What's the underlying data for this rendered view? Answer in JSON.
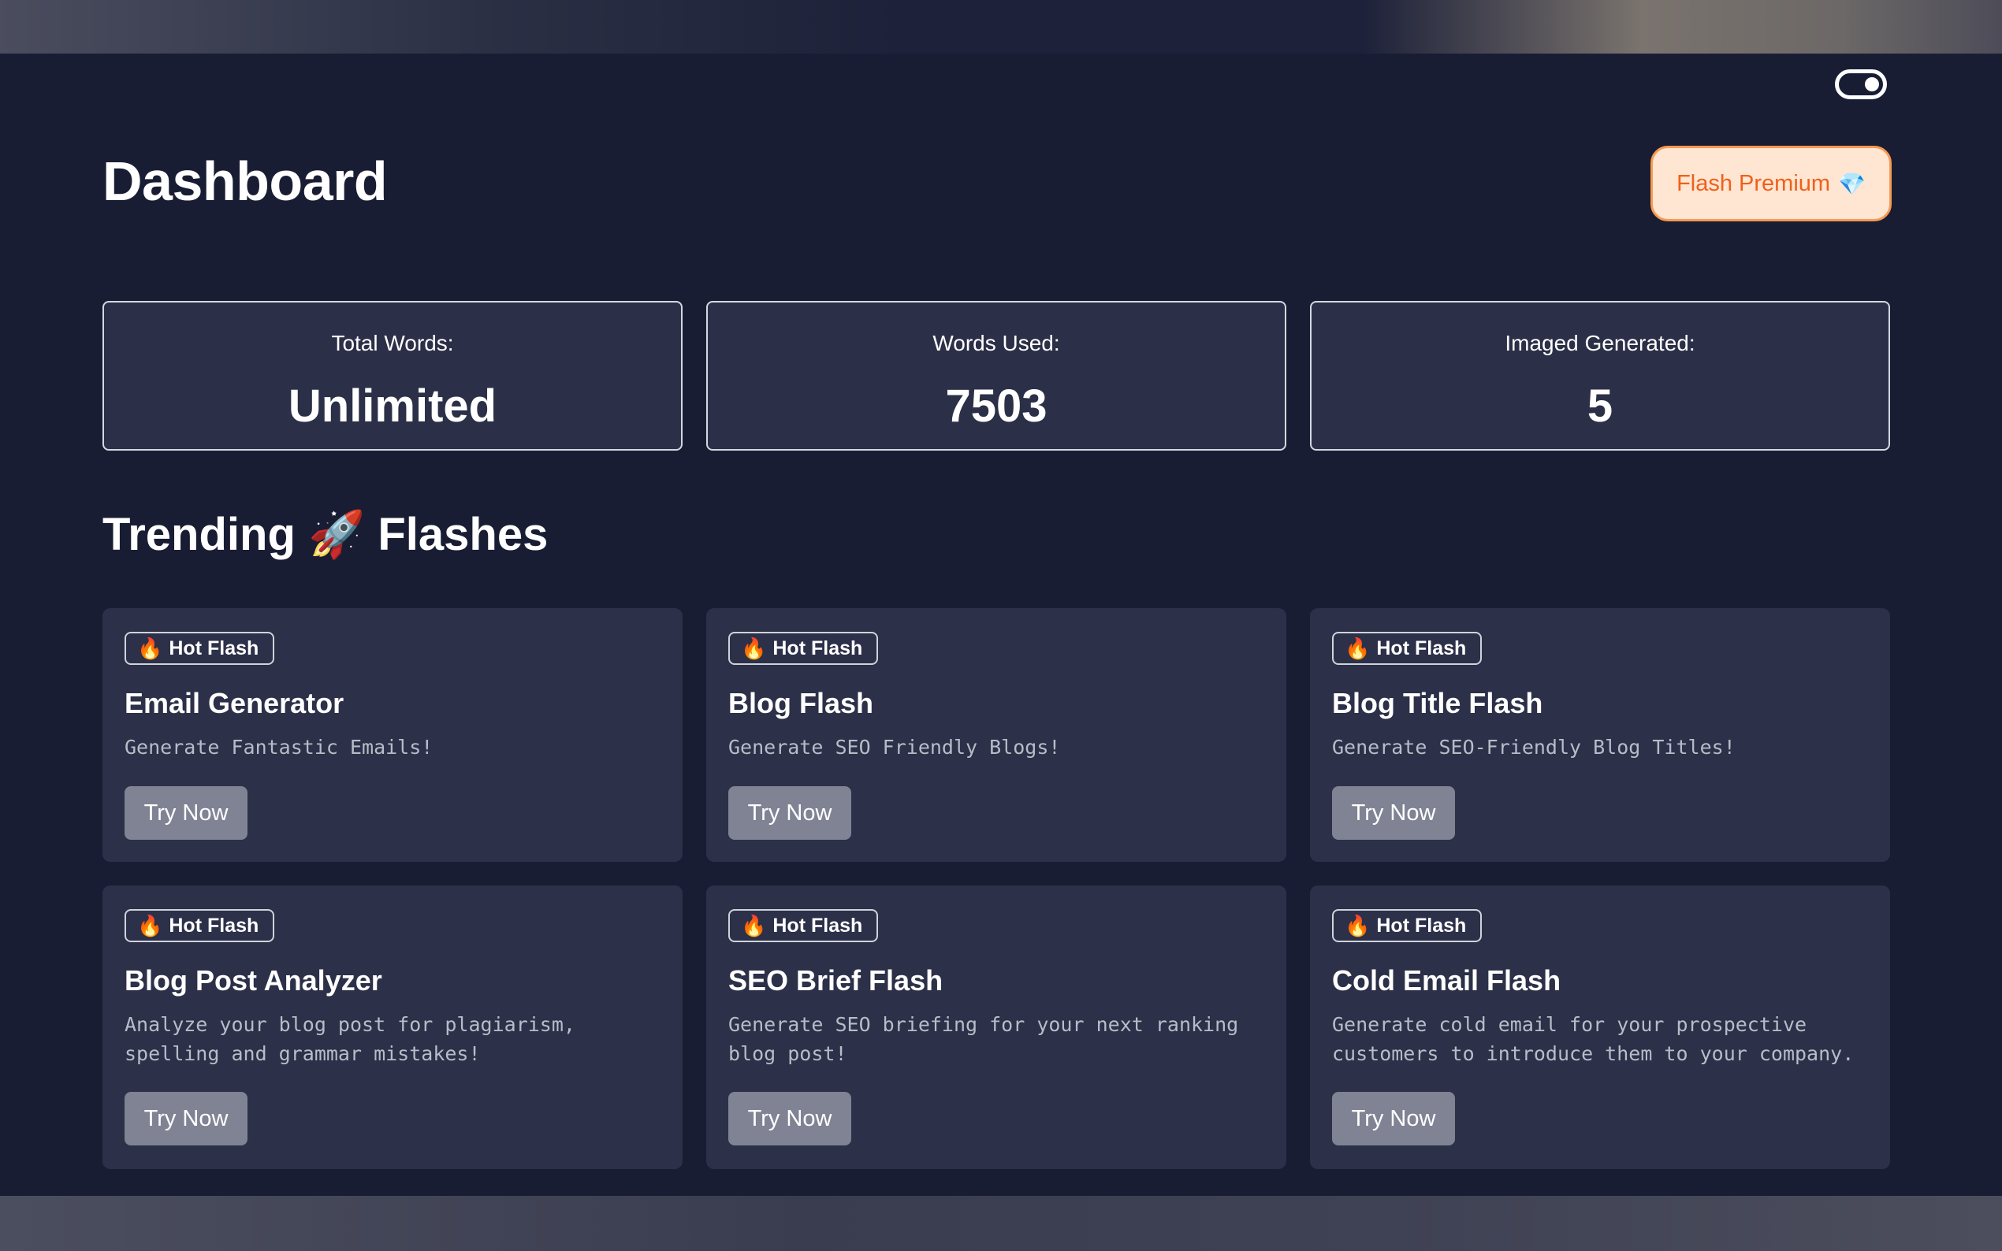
{
  "header": {
    "title": "Dashboard",
    "premium_label": "Flash Premium",
    "premium_icon": "💎"
  },
  "stats": [
    {
      "label": "Total Words:",
      "value": "Unlimited"
    },
    {
      "label": "Words Used:",
      "value": "7503"
    },
    {
      "label": "Imaged Generated:",
      "value": "5"
    }
  ],
  "section": {
    "title_before": "Trending",
    "title_icon": "🚀",
    "title_after": "Flashes"
  },
  "badge": {
    "icon": "🔥",
    "label": "Hot Flash"
  },
  "cards": [
    {
      "title": "Email Generator",
      "desc": "Generate Fantastic Emails!",
      "button": "Try Now"
    },
    {
      "title": "Blog Flash",
      "desc": "Generate SEO Friendly Blogs!",
      "button": "Try Now"
    },
    {
      "title": "Blog Title Flash",
      "desc": "Generate SEO-Friendly Blog Titles!",
      "button": "Try Now"
    },
    {
      "title": "Blog Post Analyzer",
      "desc": "Analyze your blog post for plagiarism, spelling and grammar mistakes!",
      "button": "Try Now"
    },
    {
      "title": "SEO Brief Flash",
      "desc": "Generate SEO briefing for your next ranking blog post!",
      "button": "Try Now"
    },
    {
      "title": "Cold Email Flash",
      "desc": "Generate cold email for your prospective customers to introduce them to your company.",
      "button": "Try Now"
    }
  ],
  "colors": {
    "background": "#191d34",
    "card": "#2c3048",
    "premium_bg": "#ffe6d2",
    "premium_text": "#f0601a",
    "button": "#7f8394"
  }
}
